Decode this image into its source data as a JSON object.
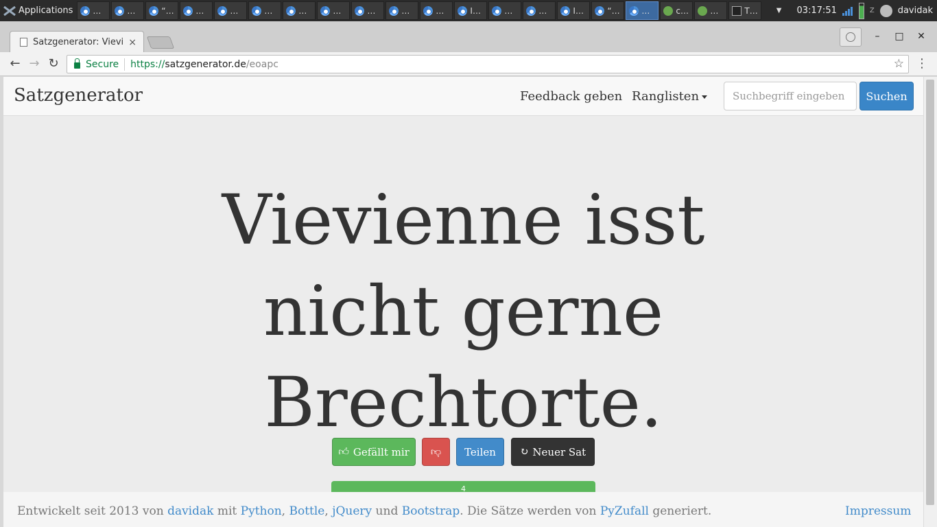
{
  "taskbar": {
    "apps_label": "Applications",
    "tasks": [
      {
        "icon": "chrome",
        "label": "…"
      },
      {
        "icon": "chrome",
        "label": "…"
      },
      {
        "icon": "chrome",
        "label": "“…"
      },
      {
        "icon": "chrome",
        "label": "…"
      },
      {
        "icon": "chrome",
        "label": "…"
      },
      {
        "icon": "chrome",
        "label": "…"
      },
      {
        "icon": "chrome",
        "label": "…"
      },
      {
        "icon": "chrome",
        "label": "…"
      },
      {
        "icon": "chrome",
        "label": "…"
      },
      {
        "icon": "chrome",
        "label": "…"
      },
      {
        "icon": "chrome",
        "label": "…"
      },
      {
        "icon": "chrome",
        "label": "I…"
      },
      {
        "icon": "chrome",
        "label": "…"
      },
      {
        "icon": "chrome",
        "label": "…"
      },
      {
        "icon": "chrome",
        "label": "I…"
      },
      {
        "icon": "chrome",
        "label": "“…"
      },
      {
        "icon": "chrome",
        "label": "…",
        "active": true
      },
      {
        "icon": "green",
        "label": "c…"
      },
      {
        "icon": "green",
        "label": "…"
      },
      {
        "icon": "terminal",
        "label": "T…"
      }
    ],
    "clock": "03:17:51",
    "user": "davidak"
  },
  "browser": {
    "tab_title": "Satzgenerator: Vievi",
    "tab_close": "×",
    "win_minimize": "–",
    "win_maximize": "□",
    "win_close": "✕",
    "secure_label": "Secure",
    "url_scheme": "https://",
    "url_host": "satzgenerator.de",
    "url_path": "/eoapc"
  },
  "navbar": {
    "brand": "Satzgenerator",
    "feedback": "Feedback geben",
    "ranglisten": "Ranglisten",
    "search_placeholder": "Suchbegriff eingeben",
    "search_button": "Suchen"
  },
  "hero": {
    "line1": "Vievienne isst",
    "line2": "nicht gerne",
    "line3": "Brechtorte.",
    "like_label": "Gefällt mir",
    "share_label": "Teilen",
    "new_label": "Neuer Sat",
    "vote_count": "4",
    "vote_fraction": 1.0
  },
  "footer": {
    "prefix": "Entwickelt seit 2013 von ",
    "author": "davidak",
    "mit": " mit ",
    "python": "Python",
    "comma1": ", ",
    "bottle": "Bottle",
    "comma2": ", ",
    "jquery": "jQuery",
    "und": " und ",
    "bootstrap": "Bootstrap",
    "middle": ". Die Sätze werden von ",
    "pyzufall": "PyZufall",
    "suffix": " generiert.",
    "impressum": "Impressum"
  },
  "colors": {
    "accent": "#428bca",
    "like": "#5cb85c",
    "dislike": "#d9534f",
    "dark": "#333333"
  }
}
